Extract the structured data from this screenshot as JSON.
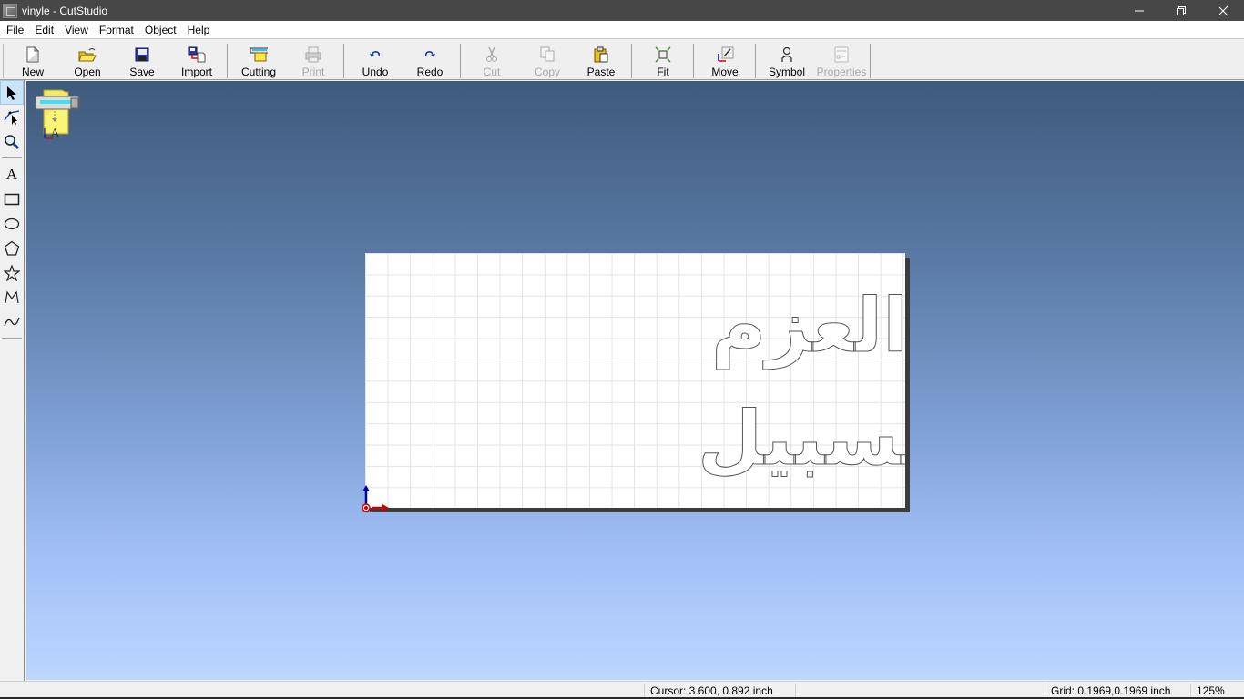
{
  "window": {
    "title": "vinyle - CutStudio",
    "minimize_label": "—",
    "restore_label": "❐",
    "close_label": "✕"
  },
  "menu": [
    {
      "label": "File",
      "accel": "F",
      "rest": "ile"
    },
    {
      "label": "Edit",
      "accel": "E",
      "rest": "dit"
    },
    {
      "label": "View",
      "accel": "V",
      "rest": "iew"
    },
    {
      "label": "Format",
      "pre": "Forma",
      "accel": "t"
    },
    {
      "label": "Object",
      "accel": "O",
      "rest": "bject"
    },
    {
      "label": "Help",
      "accel": "H",
      "rest": "elp"
    }
  ],
  "toolbar": {
    "buttons": [
      {
        "id": "new",
        "label": "New",
        "icon": "new-document-icon",
        "enabled": true
      },
      {
        "id": "open",
        "label": "Open",
        "icon": "open-folder-icon",
        "enabled": true
      },
      {
        "id": "save",
        "label": "Save",
        "icon": "save-disk-icon",
        "enabled": true
      },
      {
        "id": "import",
        "label": "Import",
        "icon": "import-icon",
        "enabled": true
      },
      {
        "id": "cutting",
        "label": "Cutting",
        "icon": "cutting-icon",
        "enabled": true
      },
      {
        "id": "print",
        "label": "Print",
        "icon": "printer-icon",
        "enabled": false
      },
      {
        "id": "undo",
        "label": "Undo",
        "icon": "undo-icon",
        "enabled": true
      },
      {
        "id": "redo",
        "label": "Redo",
        "icon": "redo-icon",
        "enabled": true
      },
      {
        "id": "cut",
        "label": "Cut",
        "icon": "scissors-icon",
        "enabled": false
      },
      {
        "id": "copy",
        "label": "Copy",
        "icon": "copy-icon",
        "enabled": false
      },
      {
        "id": "paste",
        "label": "Paste",
        "icon": "paste-icon",
        "enabled": true
      },
      {
        "id": "fit",
        "label": "Fit",
        "icon": "fit-icon",
        "enabled": true
      },
      {
        "id": "move",
        "label": "Move",
        "icon": "move-icon",
        "enabled": true
      },
      {
        "id": "symbol",
        "label": "Symbol",
        "icon": "symbol-icon",
        "enabled": true
      },
      {
        "id": "properties",
        "label": "Properties",
        "icon": "properties-icon",
        "enabled": false
      }
    ]
  },
  "tools": [
    {
      "name": "select",
      "icon": "select-arrow-icon",
      "active": true
    },
    {
      "name": "edit-points",
      "icon": "edit-points-icon",
      "active": false
    },
    {
      "name": "zoom",
      "icon": "magnifier-icon",
      "active": false
    },
    {
      "name": "text",
      "icon": "text-tool-icon",
      "glyph": "A",
      "active": false
    },
    {
      "name": "rectangle",
      "icon": "rectangle-icon",
      "active": false
    },
    {
      "name": "ellipse",
      "icon": "ellipse-icon",
      "active": false
    },
    {
      "name": "polygon",
      "icon": "polygon-icon",
      "active": false
    },
    {
      "name": "star",
      "icon": "star-icon",
      "active": false
    },
    {
      "name": "polyline",
      "icon": "polyline-icon",
      "active": false
    },
    {
      "name": "curve",
      "icon": "curve-icon",
      "active": false
    }
  ],
  "document": {
    "text_line_1": "وإن صدقت العزم",
    "text_line_2": "لوجدت السبيل"
  },
  "status": {
    "cursor": "Cursor: 3.600, 0.892 inch",
    "grid": "Grid: 0.1969,0.1969 inch",
    "zoom": "125%"
  },
  "colors": {
    "titlebar": "#474747",
    "canvas_top": "#3e5a7c",
    "canvas_bottom": "#bcd6fd",
    "axis_y": "#0000a0",
    "axis_x": "#d00000"
  }
}
